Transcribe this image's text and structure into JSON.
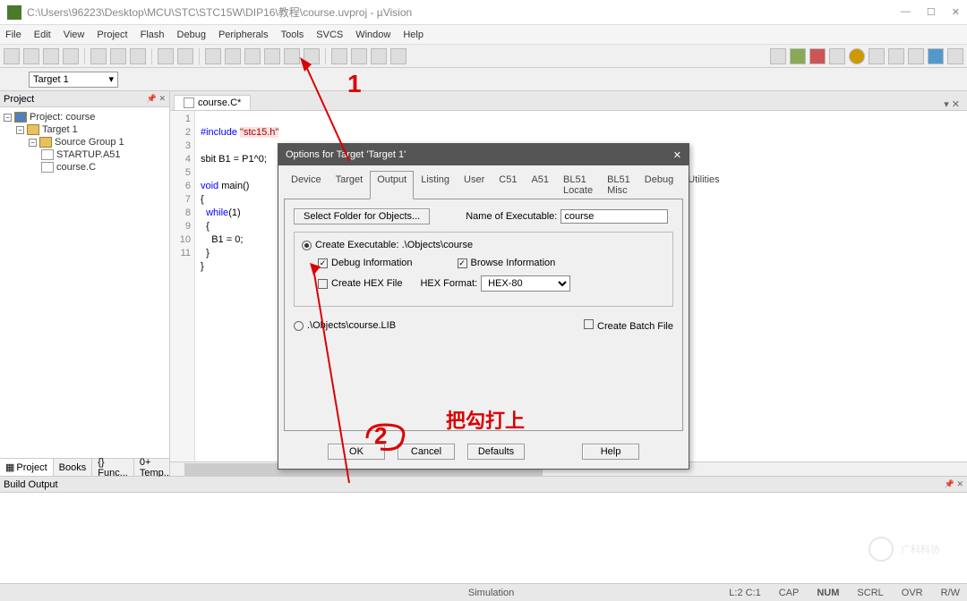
{
  "window": {
    "title": "C:\\Users\\96223\\Desktop\\MCU\\STC\\STC15W\\DIP16\\教程\\course.uvproj - µVision",
    "min": "—",
    "max": "☐",
    "close": "✕"
  },
  "menu": [
    "File",
    "Edit",
    "View",
    "Project",
    "Flash",
    "Debug",
    "Peripherals",
    "Tools",
    "SVCS",
    "Window",
    "Help"
  ],
  "toolbar2": {
    "target": "Target 1"
  },
  "project": {
    "title": "Project",
    "root": "Project: course",
    "target": "Target 1",
    "group": "Source Group 1",
    "files": [
      "STARTUP.A51",
      "course.C"
    ],
    "tabs": {
      "project": "Project",
      "books": "Books",
      "func": "{} Func...",
      "temp": "0+ Temp..."
    }
  },
  "editor": {
    "tab": "course.C*",
    "close_x": "▾ ✕",
    "gutter": [
      "1",
      "2",
      "3",
      "4",
      "5",
      "6",
      "7",
      "8",
      "9",
      "10",
      "11"
    ],
    "code": {
      "l1a": "#include ",
      "l1b": "\"stc15.h\"",
      "l3": "sbit B1 = P1^0;",
      "l5a": "void",
      "l5b": " main()",
      "l6": "{",
      "l7a": "  while",
      "l7b": "(1)",
      "l8": "  {",
      "l9": "    B1 = 0;",
      "l10": "  }",
      "l11": "}"
    }
  },
  "dialog": {
    "title": "Options for Target 'Target 1'",
    "close": "✕",
    "tabs": [
      "Device",
      "Target",
      "Output",
      "Listing",
      "User",
      "C51",
      "A51",
      "BL51 Locate",
      "BL51 Misc",
      "Debug",
      "Utilities"
    ],
    "active_tab": "Output",
    "select_folder": "Select Folder for Objects...",
    "name_exec_label": "Name of Executable:",
    "name_exec_value": "course",
    "create_exec": "Create Executable:  .\\Objects\\course",
    "debug_info": "Debug Information",
    "browse_info": "Browse Information",
    "create_hex": "Create HEX File",
    "hex_format_label": "HEX Format:",
    "hex_format_value": "HEX-80",
    "create_lib": ".\\Objects\\course.LIB",
    "create_batch": "Create Batch File",
    "ok": "OK",
    "cancel": "Cancel",
    "defaults": "Defaults",
    "help": "Help"
  },
  "build": {
    "title": "Build Output"
  },
  "status": {
    "sim": "Simulation",
    "pos": "L:2 C:1",
    "caps": "CAP",
    "num": "NUM",
    "scrl": "SCRL",
    "ovr": "OVR",
    "rw": "R/W"
  },
  "annotations": {
    "n1": "1",
    "n2": "2",
    "text": "把勾打上",
    "wm": "广科科协"
  }
}
